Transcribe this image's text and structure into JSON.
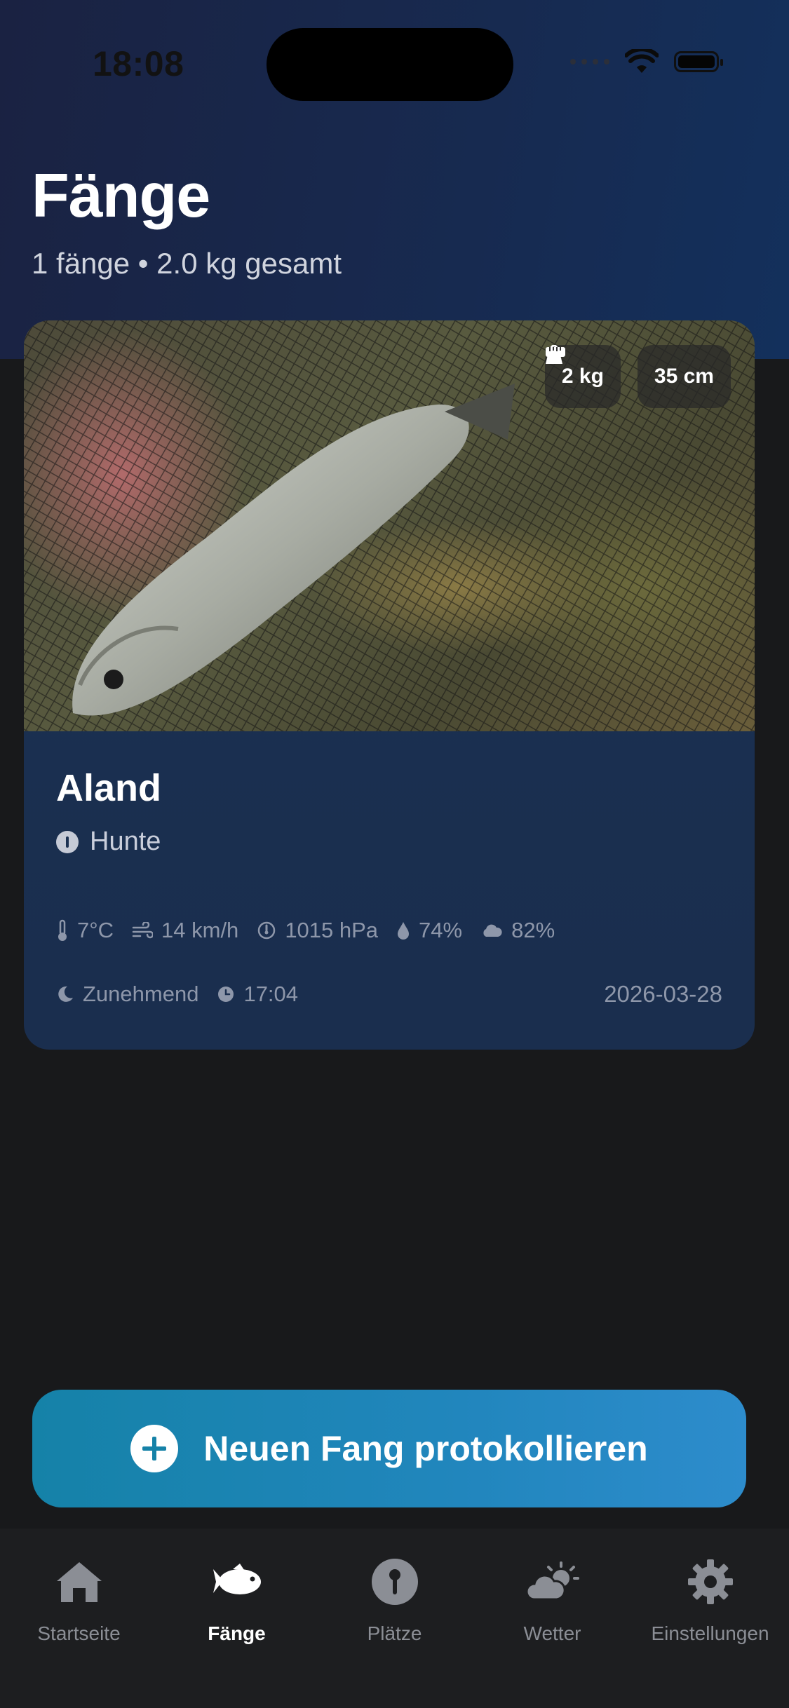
{
  "status_bar": {
    "time": "18:08"
  },
  "header": {
    "title": "Fänge",
    "subtitle": "1 fänge • 2.0 kg gesamt"
  },
  "catch_card": {
    "weight": "2 kg",
    "length": "35 cm",
    "species": "Aland",
    "location": "Hunte",
    "weather": {
      "temperature": "7°C",
      "wind": "14 km/h",
      "pressure": "1015 hPa",
      "humidity": "74%",
      "cloud_cover": "82%"
    },
    "moon_phase": "Zunehmend",
    "time": "17:04",
    "date": "2026-03-28"
  },
  "cta": {
    "label": "Neuen Fang protokollieren"
  },
  "tabbar": {
    "items": [
      {
        "label": "Startseite",
        "icon": "home-icon"
      },
      {
        "label": "Fänge",
        "icon": "fish-icon"
      },
      {
        "label": "Plätze",
        "icon": "pin-icon"
      },
      {
        "label": "Wetter",
        "icon": "weather-icon"
      },
      {
        "label": "Einstellungen",
        "icon": "gear-icon"
      }
    ],
    "active_index": 1
  },
  "colors": {
    "background": "#18191b",
    "header_gradient_start": "#1a2242",
    "header_gradient_end": "#13305c",
    "card": "#1b3152",
    "accent": "#1582a8",
    "tab_inactive": "#8b8e95"
  }
}
